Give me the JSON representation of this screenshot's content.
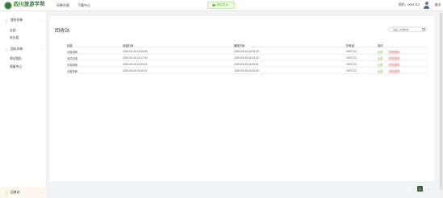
{
  "header": {
    "logo_text": "四川旅游学院",
    "logo_subtext": "SICHUAN TOURISM UNIVERSITY",
    "nav": [
      "问卷列表",
      "下载中心"
    ],
    "toast": "删除成功",
    "user": "您好，0001712",
    "logout": "退出"
  },
  "sidebar": {
    "groups": [
      {
        "label": "我的问卷",
        "items": [
          "全部",
          "未分组"
        ]
      },
      {
        "label": "团队问卷",
        "items": [
          "测试团队",
          "测量中心"
        ]
      }
    ],
    "bottom": "回收站"
  },
  "main": {
    "title": "回收站",
    "search_placeholder": "请输入问卷标题",
    "columns": [
      "标题",
      "创建时间",
      "删除时间",
      "所有者",
      "操作"
    ],
    "rows": [
      {
        "title": "问卷调研",
        "created": "2020-04-28 14:09:54",
        "deleted": "2020-05-06 16:33:25",
        "owner": "0001712",
        "restore": "还原",
        "purge": "彻底删除"
      },
      {
        "title": "测试问卷",
        "created": "2020-05-06 16:17:50",
        "deleted": "2020-05-06 16:33:23",
        "owner": "0001712",
        "restore": "还原",
        "purge": "彻底删除"
      },
      {
        "title": "问卷调研",
        "created": "2020-05-06 16:20:24",
        "deleted": "2020-05-06 16:33:21",
        "owner": "0001712",
        "restore": "还原",
        "purge": "彻底删除"
      },
      {
        "title": "问卷调研",
        "created": "2020-05-06 16:20:57",
        "deleted": "2020-05-06 16:33:18",
        "owner": "0001712",
        "restore": "还原",
        "purge": "彻底删除"
      }
    ]
  },
  "pagination": {
    "prev": "<",
    "current": "1",
    "next": ">"
  },
  "colors": {
    "brand": "#2f6b2f",
    "accent": "#e6a23c",
    "success": "#67c23a",
    "danger": "#f56c6c"
  }
}
